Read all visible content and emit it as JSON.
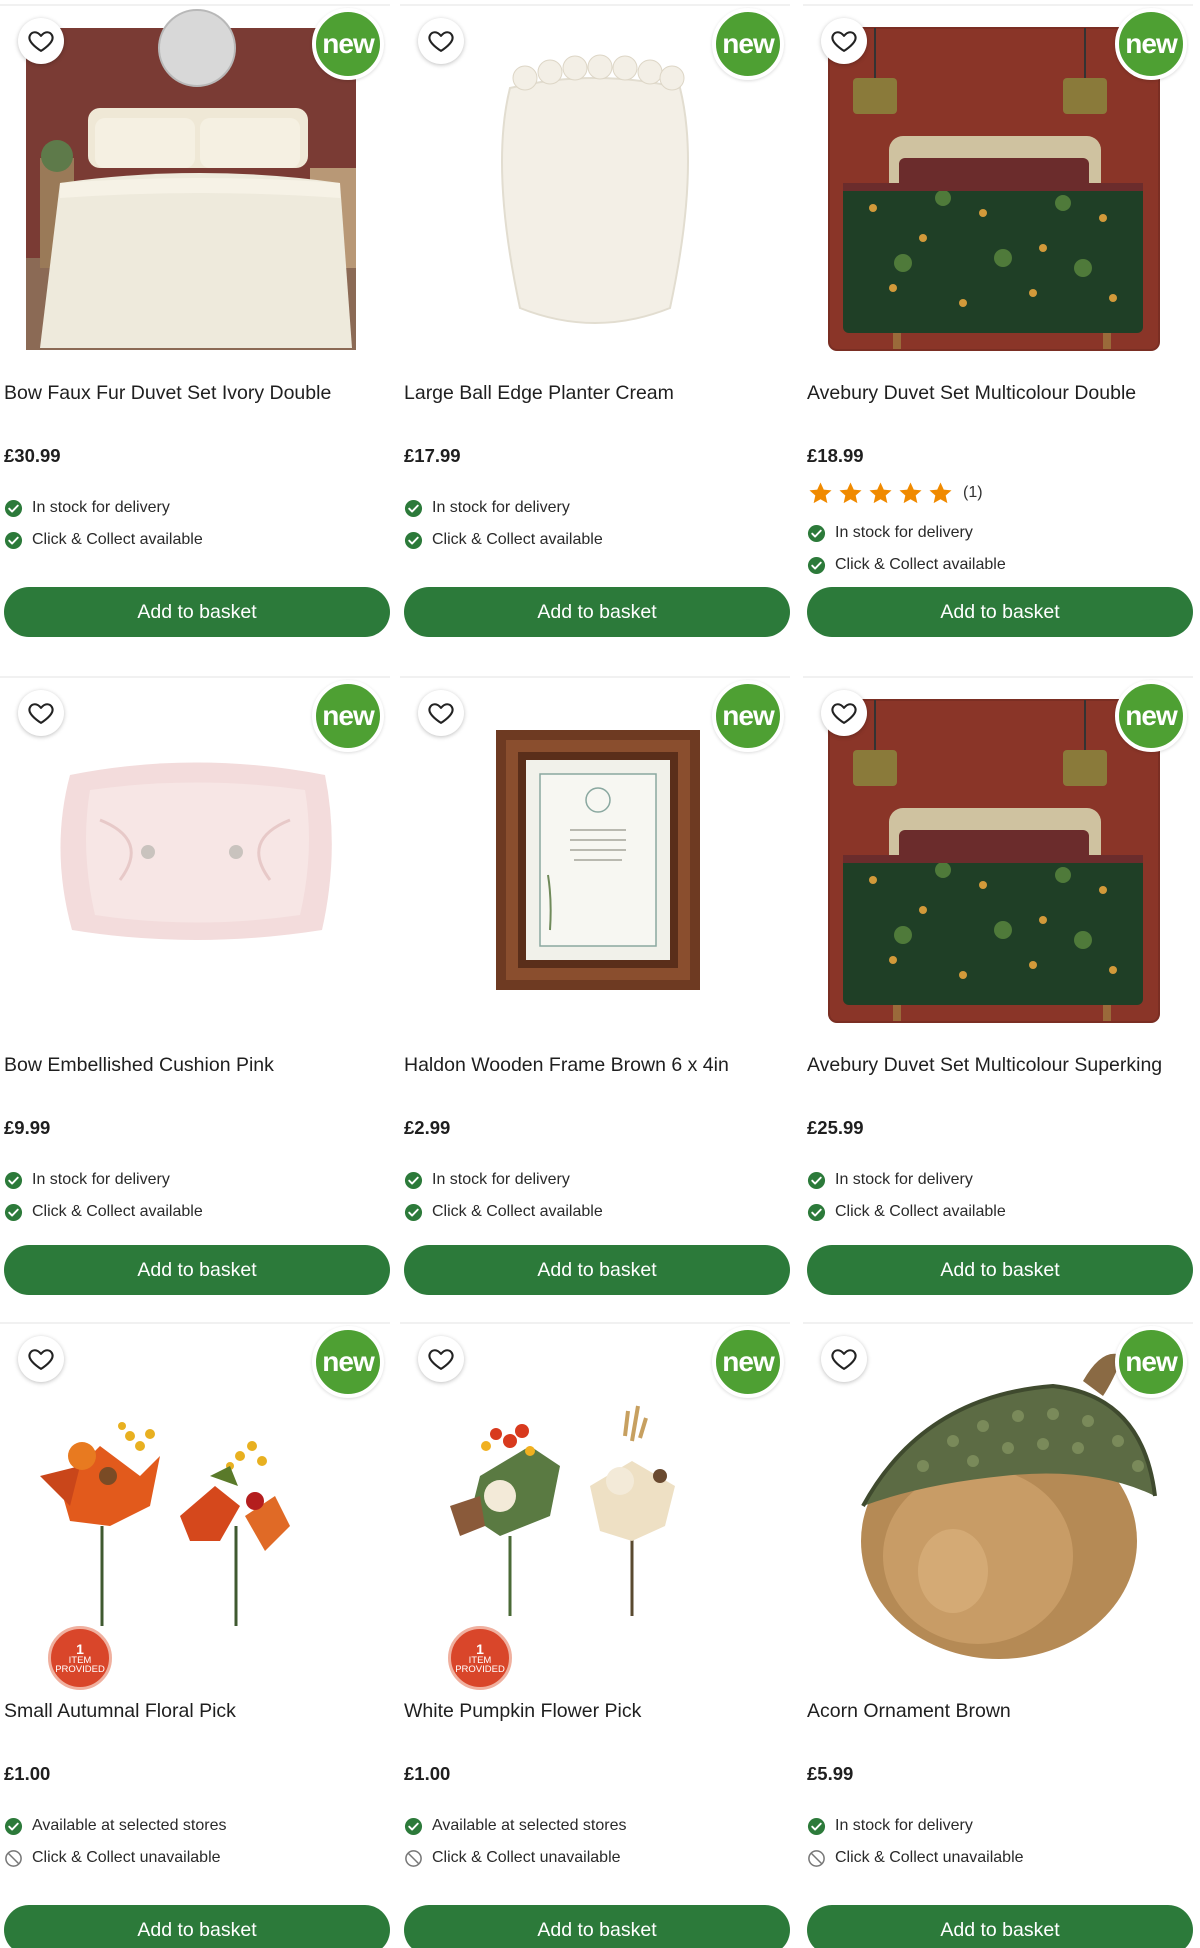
{
  "colors": {
    "accent_green": "#2c7a3a",
    "new_badge_green": "#4ea033",
    "check_green": "#2c7a3a",
    "star_orange": "#f08a00",
    "item_badge_red": "#d9462a"
  },
  "button_label": "Add to basket",
  "new_label": "new",
  "products": [
    {
      "title": "Bow Faux Fur Duvet Set Ivory Double",
      "price": "£30.99",
      "image": "bedroom-ivory-duvet",
      "availability": [
        {
          "icon": "check-icon",
          "text": "In stock for delivery"
        },
        {
          "icon": "check-icon",
          "text": "Click & Collect available"
        }
      ]
    },
    {
      "title": "Large Ball Edge Planter Cream",
      "price": "£17.99",
      "image": "cream-planter",
      "availability": [
        {
          "icon": "check-icon",
          "text": "In stock for delivery"
        },
        {
          "icon": "check-icon",
          "text": "Click & Collect available"
        }
      ]
    },
    {
      "title": "Avebury Duvet Set Multicolour Double",
      "price": "£18.99",
      "image": "green-woodland-duvet",
      "rating": {
        "stars": 5,
        "count": "(1)"
      },
      "availability": [
        {
          "icon": "check-icon",
          "text": "In stock for delivery"
        },
        {
          "icon": "check-icon",
          "text": "Click & Collect available"
        }
      ]
    },
    {
      "title": "Bow Embellished Cushion Pink",
      "price": "£9.99",
      "image": "pink-satin-cushion",
      "availability": [
        {
          "icon": "check-icon",
          "text": "In stock for delivery"
        },
        {
          "icon": "check-icon",
          "text": "Click & Collect available"
        }
      ]
    },
    {
      "title": "Haldon Wooden Frame Brown 6 x 4in",
      "price": "£2.99",
      "image": "wooden-photo-frame",
      "availability": [
        {
          "icon": "check-icon",
          "text": "In stock for delivery"
        },
        {
          "icon": "check-icon",
          "text": "Click & Collect available"
        }
      ]
    },
    {
      "title": "Avebury Duvet Set Multicolour Superking",
      "price": "£25.99",
      "image": "green-woodland-duvet",
      "availability": [
        {
          "icon": "check-icon",
          "text": "In stock for delivery"
        },
        {
          "icon": "check-icon",
          "text": "Click & Collect available"
        }
      ]
    },
    {
      "title": "Small Autumnal Floral Pick",
      "price": "£1.00",
      "image": "autumn-floral-pick",
      "item_badge": {
        "number": "1",
        "line1": "ITEM",
        "line2": "PROVIDED"
      },
      "availability": [
        {
          "icon": "check-icon",
          "text": "Available at selected stores"
        },
        {
          "icon": "unavailable-icon",
          "text": "Click & Collect unavailable"
        }
      ]
    },
    {
      "title": "White Pumpkin Flower Pick",
      "price": "£1.00",
      "image": "white-pumpkin-pick",
      "item_badge": {
        "number": "1",
        "line1": "ITEM",
        "line2": "PROVIDED"
      },
      "availability": [
        {
          "icon": "check-icon",
          "text": "Available at selected stores"
        },
        {
          "icon": "unavailable-icon",
          "text": "Click & Collect unavailable"
        }
      ]
    },
    {
      "title": "Acorn Ornament Brown",
      "price": "£5.99",
      "image": "acorn-ornament",
      "availability": [
        {
          "icon": "check-icon",
          "text": "In stock for delivery"
        },
        {
          "icon": "unavailable-icon",
          "text": "Click & Collect unavailable"
        }
      ]
    }
  ]
}
